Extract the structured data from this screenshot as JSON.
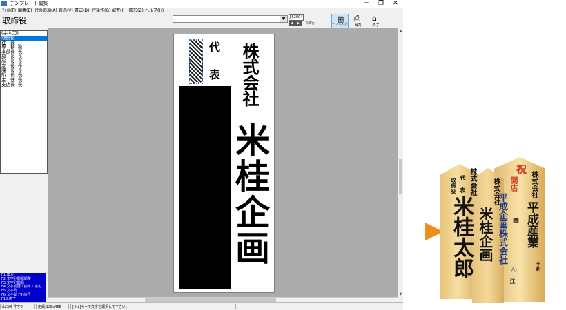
{
  "window": {
    "title": "テンプレート編集",
    "controls": [
      "─",
      "❐",
      "✕"
    ]
  },
  "menu": [
    "ﾌｧｲﾙ(F)",
    "編集(E)",
    "行の追加(A)",
    "表示(V)",
    "書式(D)",
    "行操作(G)",
    "配置(I)",
    "図形(Z)",
    "ヘルプ(H)"
  ],
  "toolbar": {
    "field_label": "取締役",
    "size_label": "JIS2004",
    "nav_prev": "◀",
    "nav_next": "▶",
    "page_indicator": "4/5行",
    "buttons": [
      {
        "icon": "▦",
        "label": "ﾃﾝﾌﾟﾚ入力",
        "icon_name": "template-input-icon"
      },
      {
        "icon": "⎙",
        "label": "出力",
        "icon_name": "printer-icon"
      },
      {
        "icon": "⌂",
        "label": "終了",
        "icon_name": "exit-icon"
      }
    ]
  },
  "title_list": [
    "(手入力)",
    "取締役",
    "社　長",
    "専　務",
    "本部長",
    "部　長",
    "局　長",
    "次　長",
    "課　長",
    "所　長",
    "主　任",
    "支店長"
  ],
  "title_list_side": [
    "",
    "",
    "",
    "務",
    "長",
    "長",
    "長",
    "長",
    "長",
    "長",
    "長",
    "長"
  ],
  "selected_title_index": 1,
  "plaque": {
    "company": "株式会社",
    "name": "米桂企画",
    "role_top": "代",
    "role_bottom": "表"
  },
  "help_panel": [
    "F1:出力",
    "F2:文字列間隔調整",
    "F3:文字列間隔",
    "F4:文字変更・揃え・揃え",
    "F5:文字列",
    "F6:文字間 F9:前行",
    "F10:終了"
  ],
  "status": {
    "mode": "山口幹 件字0",
    "size": "用紙:125x455",
    "message": "[↑↓]キーで文字を選択して下さい。"
  },
  "promo": {
    "arrow": "▶",
    "left_plaque": {
      "role_1": "代",
      "role_2": "表",
      "role_left_1": "取",
      "role_left_2": "締",
      "role_left_3": "役",
      "company": "株式会社",
      "name": "米桂太郎"
    },
    "middle_plaque": {
      "company": "株式会社",
      "name": "米桂企画"
    },
    "right_plaque": {
      "top": "祝",
      "event": "開店",
      "kind": "平成企画株式会社",
      "company": "株式会社",
      "name": "平成産業",
      "note": "手利",
      "seal": "贈",
      "sign_1": "ん",
      "sign_2": "江"
    }
  }
}
